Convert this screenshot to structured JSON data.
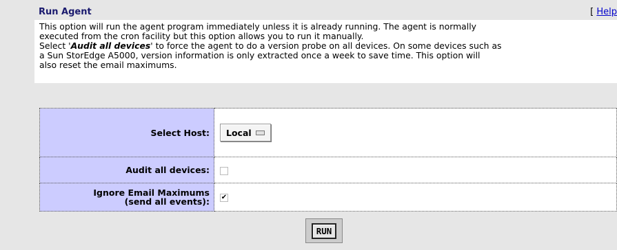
{
  "header": {
    "title": "Run Agent",
    "help_bracket": "[",
    "help_link": "Help"
  },
  "description": {
    "line1": "This option will run the agent program immediately unless it is already running. The agent is normally",
    "line2": "executed from the cron facility but this option allows you to run it manually.",
    "line3_prefix": "Select '",
    "line3_bold": "Audit all devices",
    "line3_suffix": "' to force the agent to do a version probe on all devices. On some devices such as",
    "line4": "a Sun StorEdge A5000, version information is only extracted once a week to save time. This option will",
    "line5": "also reset the email maximums."
  },
  "form": {
    "host_label": "Select Host:",
    "host_value": "Local",
    "audit_label": "Audit all devices:",
    "audit_checked": false,
    "ignore_label_line1": "Ignore Email Maximums",
    "ignore_label_line2": "(send all events):",
    "ignore_checked": true,
    "check_mark": "✔"
  },
  "actions": {
    "run_label": "RUN"
  }
}
